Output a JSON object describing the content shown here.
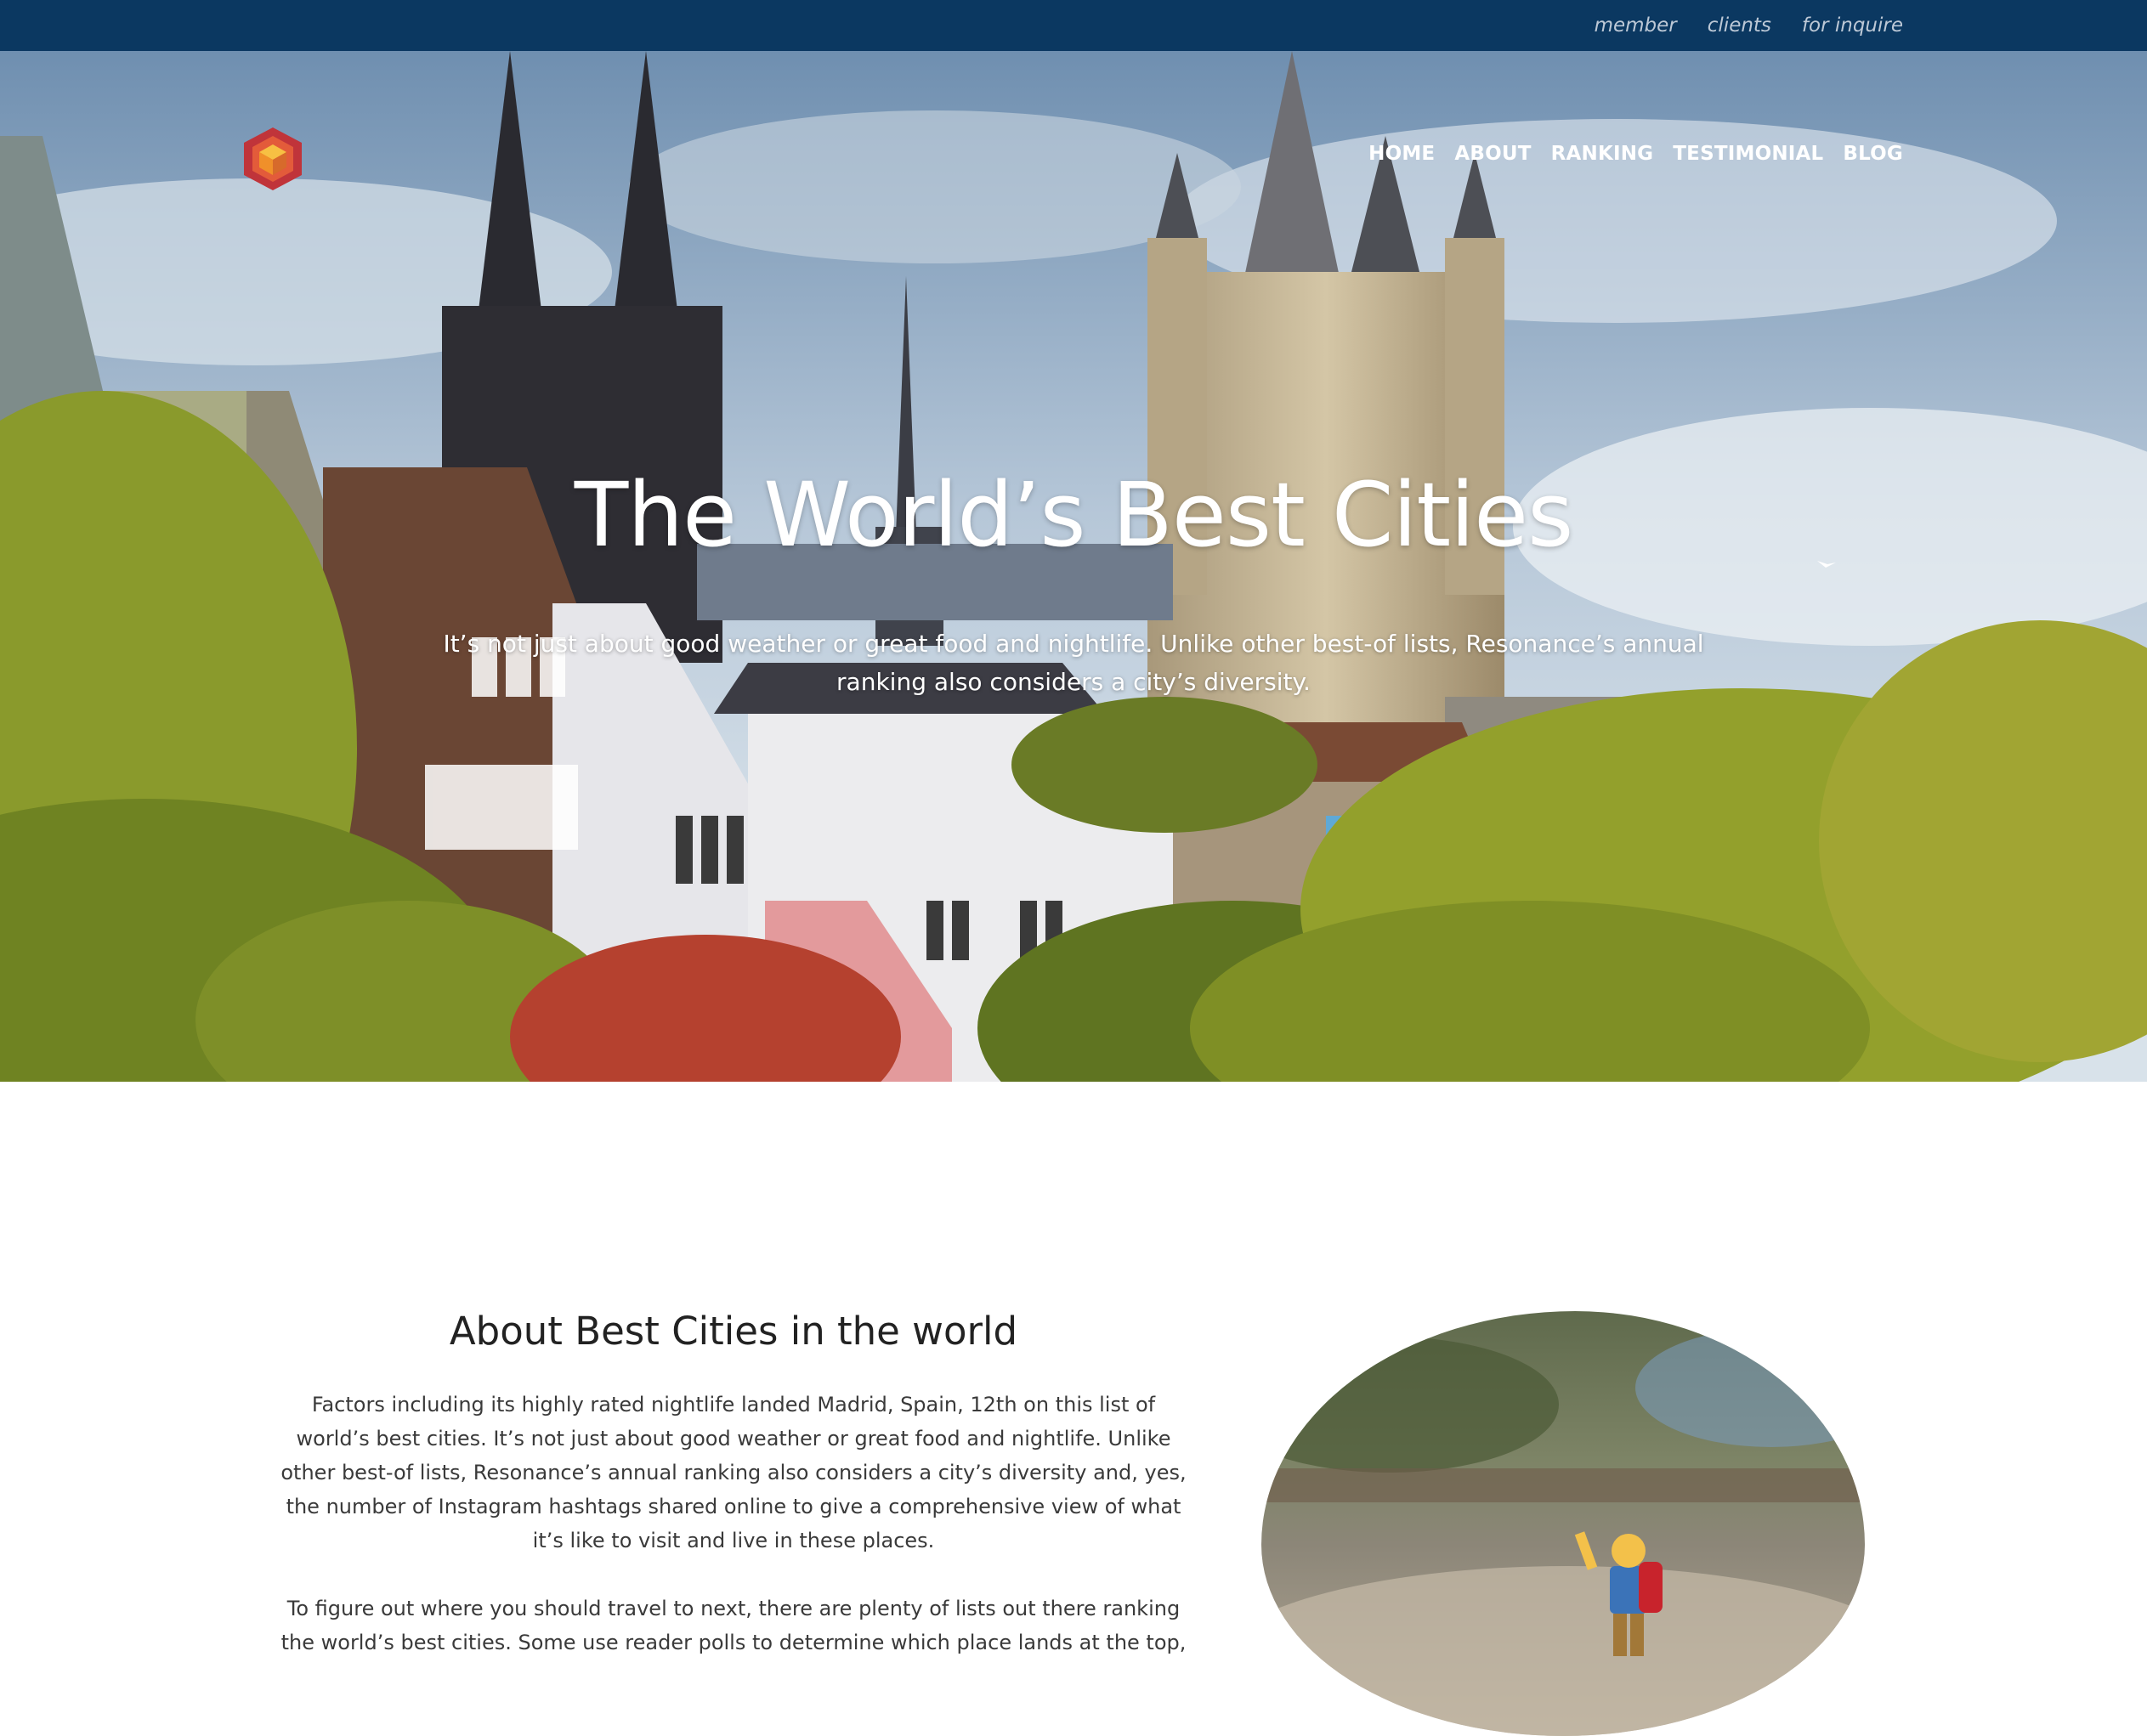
{
  "topbar": {
    "links": [
      "member",
      "clients",
      "for inquire"
    ]
  },
  "nav": {
    "items": [
      "HOME",
      "ABOUT",
      "RANKING",
      "TESTIMONIAL",
      "BLOG"
    ]
  },
  "hero": {
    "title": "The World’s Best Cities",
    "subtitle": "It’s not just about good weather or great food and nightlife. Unlike other best-of lists, Resonance’s annual ranking also considers a city’s diversity."
  },
  "about": {
    "heading": "About Best Cities in the world",
    "paragraph1": "Factors including its highly rated nightlife landed Madrid, Spain, 12th on this list of world’s best cities. It’s not just about good weather or great food and nightlife. Unlike other best-of lists, Resonance’s annual ranking also considers a city’s diversity and, yes, the number of Instagram hashtags shared online to give a comprehensive view of what it’s like to visit and live in these places.",
    "paragraph2": "To figure out where you should travel to next, there are plenty of lists out there ranking the world’s best cities. Some use reader polls to determine which place lands at the top,"
  },
  "colors": {
    "topbar": "#0b3861",
    "accent_orange": "#f0902a",
    "accent_red": "#c0343a"
  }
}
